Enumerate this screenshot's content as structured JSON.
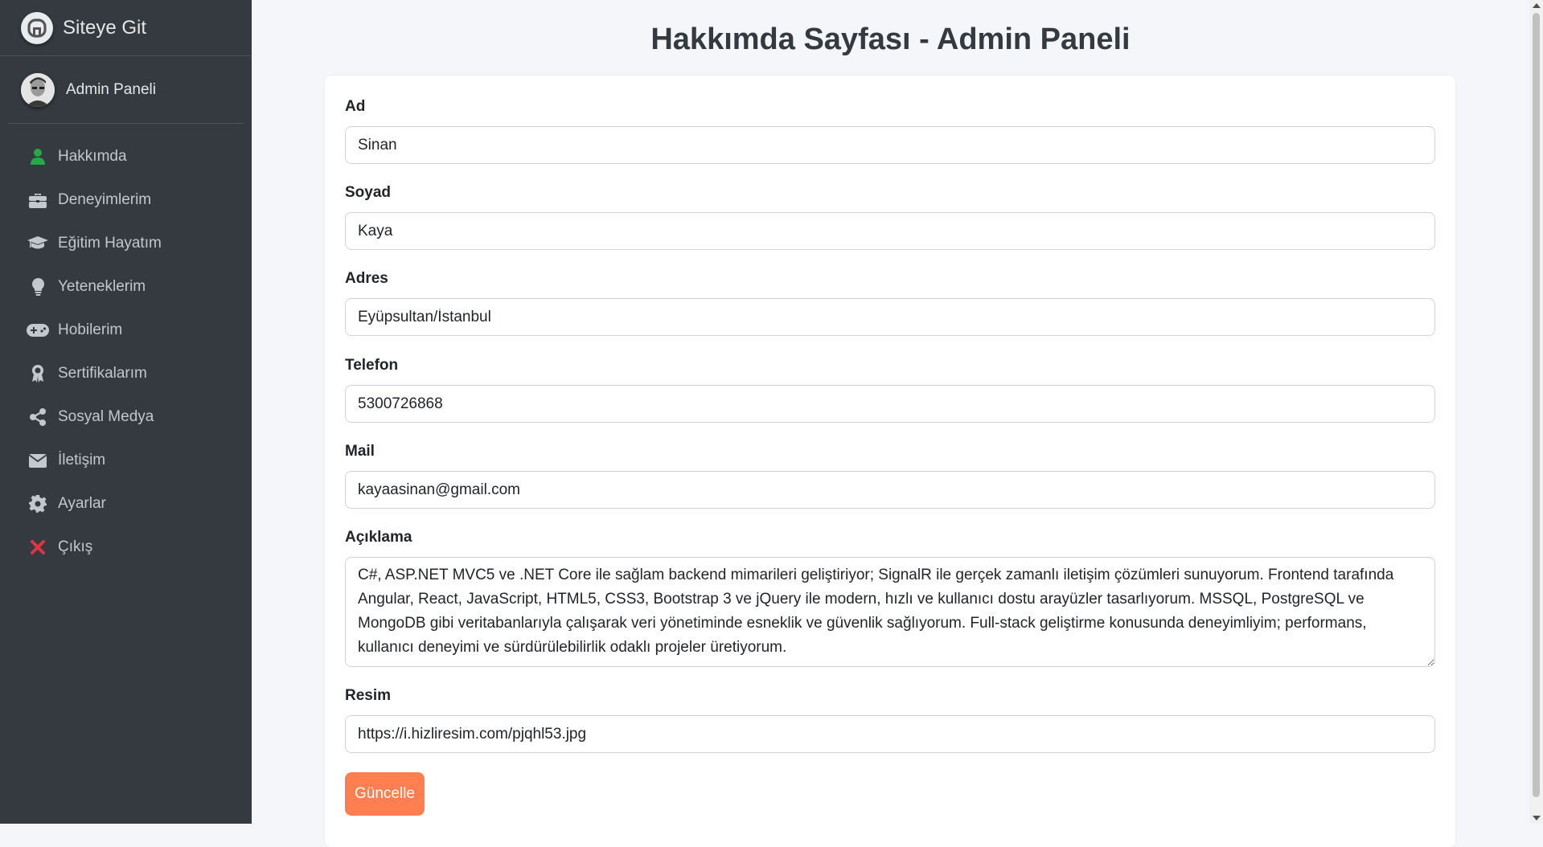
{
  "brand": {
    "text": "Siteye Git"
  },
  "user": {
    "name": "Admin Paneli"
  },
  "nav": [
    {
      "label": "Hakkımda",
      "icon": "user-icon"
    },
    {
      "label": "Deneyimlerim",
      "icon": "briefcase-icon"
    },
    {
      "label": "Eğitim Hayatım",
      "icon": "graduation-cap-icon"
    },
    {
      "label": "Yeteneklerim",
      "icon": "lightbulb-icon"
    },
    {
      "label": "Hobilerim",
      "icon": "gamepad-icon"
    },
    {
      "label": "Sertifikalarım",
      "icon": "award-icon"
    },
    {
      "label": "Sosyal Medya",
      "icon": "share-icon"
    },
    {
      "label": "İletişim",
      "icon": "envelope-icon"
    },
    {
      "label": "Ayarlar",
      "icon": "gear-icon"
    },
    {
      "label": "Çıkış",
      "icon": "close-icon"
    }
  ],
  "colors": {
    "sidebar": "#343a40",
    "active_icon": "#28a745",
    "exit_icon": "#dc3545",
    "button": "#ff7f50"
  },
  "page": {
    "title": "Hakkımda Sayfası - Admin Paneli"
  },
  "form": {
    "ad": {
      "label": "Ad",
      "value": "Sinan"
    },
    "soyad": {
      "label": "Soyad",
      "value": "Kaya"
    },
    "adres": {
      "label": "Adres",
      "value": "Eyüpsultan/İstanbul"
    },
    "telefon": {
      "label": "Telefon",
      "value": "5300726868"
    },
    "mail": {
      "label": "Mail",
      "value": "kayaasinan@gmail.com"
    },
    "aciklama": {
      "label": "Açıklama",
      "value": "C#, ASP.NET MVC5 ve .NET Core ile sağlam backend mimarileri geliştiriyor; SignalR ile gerçek zamanlı iletişim çözümleri sunuyorum. Frontend tarafında Angular, React, JavaScript, HTML5, CSS3, Bootstrap 3 ve jQuery ile modern, hızlı ve kullanıcı dostu arayüzler tasarlıyorum. MSSQL, PostgreSQL ve MongoDB gibi veritabanlarıyla çalışarak veri yönetiminde esneklik ve güvenlik sağlıyorum. Full-stack geliştirme konusunda deneyimliyim; performans, kullanıcı deneyimi ve sürdürülebilirlik odaklı projeler üretiyorum."
    },
    "resim": {
      "label": "Resim",
      "value": "https://i.hizliresim.com/pjqhl53.jpg"
    },
    "submit_label": "Güncelle"
  }
}
